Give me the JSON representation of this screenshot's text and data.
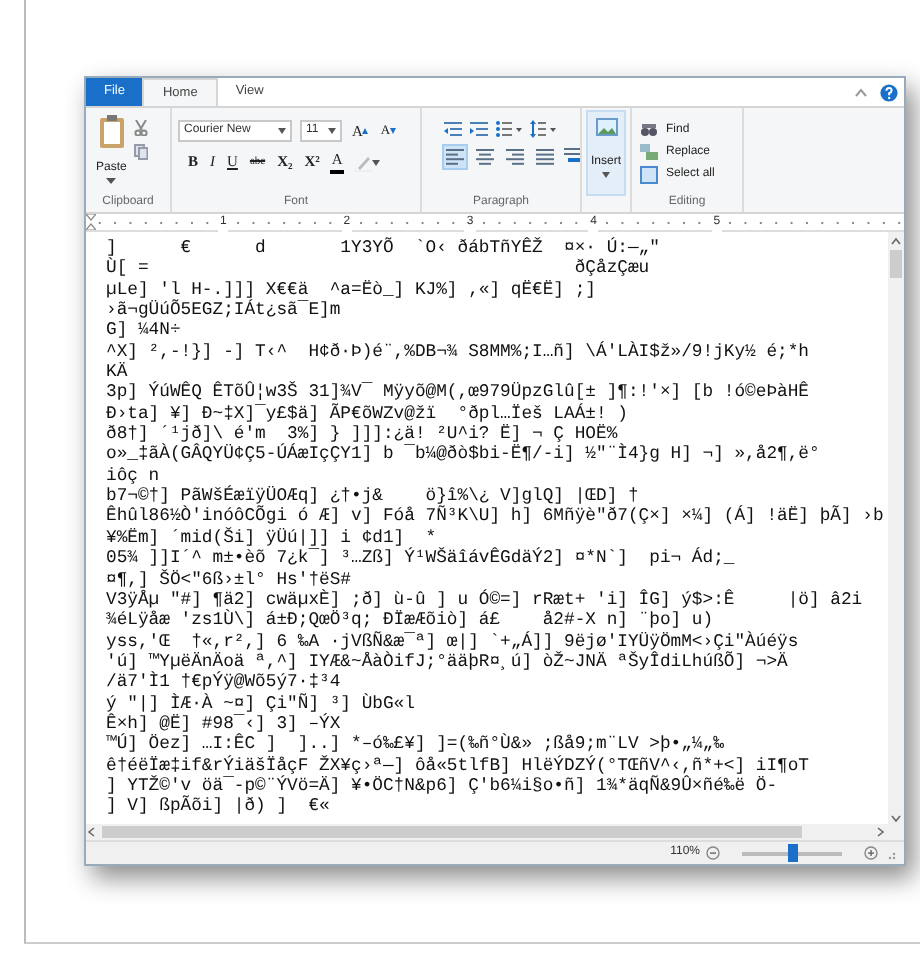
{
  "ribbon_tabs": [
    {
      "label": "File",
      "kind": "file",
      "selected": false
    },
    {
      "label": "Home",
      "kind": "tab",
      "selected": true
    },
    {
      "label": "View",
      "kind": "tab",
      "selected": false
    }
  ],
  "ribbon": {
    "clipboard": {
      "paste_label": "Paste",
      "group_label": "Clipboard"
    },
    "font": {
      "family": "Courier New",
      "size": "11",
      "grow_label": "A",
      "shrink_label": "A",
      "group_label": "Font",
      "format_buttons": [
        {
          "kind": "bold",
          "label": "B"
        },
        {
          "kind": "italic",
          "label": "I"
        },
        {
          "kind": "underline",
          "label": "U"
        },
        {
          "kind": "strike",
          "label": "abc"
        },
        {
          "kind": "subscript",
          "label": "X₂"
        },
        {
          "kind": "superscript",
          "label": "X²"
        },
        {
          "kind": "color",
          "label": "A"
        },
        {
          "kind": "highlight"
        }
      ]
    },
    "paragraph": {
      "group_label": "Paragraph",
      "align_buttons": [
        {
          "kind": "left",
          "selected": true
        },
        {
          "kind": "center",
          "selected": false
        },
        {
          "kind": "right",
          "selected": false
        },
        {
          "kind": "justify",
          "selected": false
        }
      ]
    },
    "insert": {
      "label": "Insert"
    },
    "editing": {
      "group_label": "Editing",
      "items": [
        {
          "kind": "find",
          "label": "Find"
        },
        {
          "kind": "replace",
          "label": "Replace"
        },
        {
          "kind": "select",
          "label": "Select all"
        }
      ]
    }
  },
  "ruler": {
    "numbers": [
      "1",
      "2",
      "3",
      "4",
      "5"
    ]
  },
  "document": {
    "lines": [
      "]      €      d       1Y3YÕ  `O‹ ðábTñYÊŽ  ¤×· Ú:—„\"",
      "Ù[ =                                        ðÇåzÇæu",
      "µLe] 'l H-.]]] X€€ä  ^a=Ëò_] KJ%] ,«] qË€Ë] ;]",
      "›ã¬gÜúÕ5EGZ;IÁt¿sã¯E]m",
      "G] ¼4N÷",
      "^X] ²,-!}] -] T‹^  H¢ð·Þ)é¨,%DB¬¾ S8MM%;I…ñ] \\Á'LÀI$ž»/9!jKy½ é;*h",
      "KÄ",
      "3p] ÝúWÊQ ÊTõÛ¦w3Š 31]¾V¯ Mÿyõ@M(,œ979ÜpzGlû[± ]¶:!'×] [b !ó©eÞàHÊ",
      "Ð›ta] ¥] Ð~‡X]¯y£$ä] ÃP€õWZv@žï  °ðpl…Ïeš LAÁ±! )",
      "ð8†] ´¹jð]\\ é'm  3%] } ]]]:¿ä! ²U^i? Ë] ¬ Ç HOË%",
      "o»_‡ãÀ(GÂQYÜ¢Ç5-ÚÁæIçÇY1] b ¯b¼@ðò$bi-Ë¶/-i] ½\"¨Ì4}g H] ¬] »,å2¶,ë°",
      "iôç n",
      "b7¬©†] PãWšÉæïÿÜOÆq] ¿†•j&    ö}î%\\¿ V]glQ] |ŒD] †",
      "Êhûl86½Ò'inóôCÕgi ó Æ] v] Fóå 7Ñ³K\\U] h] 6Mñÿè\"ð7(Ç×] ×¼] (Á] !äË] þÃ] ›b",
      "¥%Ëm] ´mid(Ši] ÿÜú|]] i ¢d1]  *",
      "05¾ ]]I´^ m±•èõ 7¿k¯] ³…Zß] Ý¹WŠäîávÊGdäÝ2] ¤*N`]  pi¬ Ád;_",
      "¤¶,] ŠÖ<\"6ß›±l° Hs'†ëS#",
      "V3ÿÅµ \"#] ¶ä2] cwäµxÈ] ;ð] ù-û ] u Ó©=] rRæt+ 'i] ÎG] ý$>:Ê     |ö] â2i",
      "¾éLÿåæ 'zs1Ù\\] á±Ð;QœÖ³q; ÐÏæÆõiò] á£    å2#-X n] ¨þo] u)",
      "yss,'Œ  †«,r²,] 6 ‰A ·jVßÑ&æ¯ª] œ|] `+„Á]] 9ëjø'IYÜÿÖmM<›Çi\"Àúéÿs",
      "'ú] ™YµëÄnÄoä ª,^] IYÆ&~ÅàÒifJ;°ääþR¤¸ú] òŽ~JNÄ ªŠyÎdiLhúßÕ] ¬>Ä",
      "/ä7'Ì1 †€pÝÿ@Wõ5ý7·‡³4",
      "ý \"|] ÌÆ·À ~¤] Çi\"Ñ] ³] ÙbG«l",
      "Ê×h] @Ë] #98¯‹] 3] –ÝX",
      "™Ú] Öez] …I:ÊC ]  ]..] *–ó‰£¥] ]=(‰ñ°Ù&» ;ßå9;m¨LV >þ•„¼„‰",
      "ê†éëÏæ‡if&rÝiäšÏåçF ŽX¥ç›ª—] ôå«5tlfB] HlëÝDZÝ(°TŒñV^‹,ñ*+<] iI¶oT",
      "] YTŽ©'v öä¯-p©¨ÝVö=Ä] ¥•ÖC†N&p6] Ç'b6¼i§o•ñ] 1¾*äqÑ&9Û×ñé‰ë Ö-",
      "] V] ßpÃõi] |ð) ]  €«"
    ]
  },
  "status_bar": {
    "zoom": "110%",
    "zoom_slider": {
      "level": 0.5
    }
  }
}
